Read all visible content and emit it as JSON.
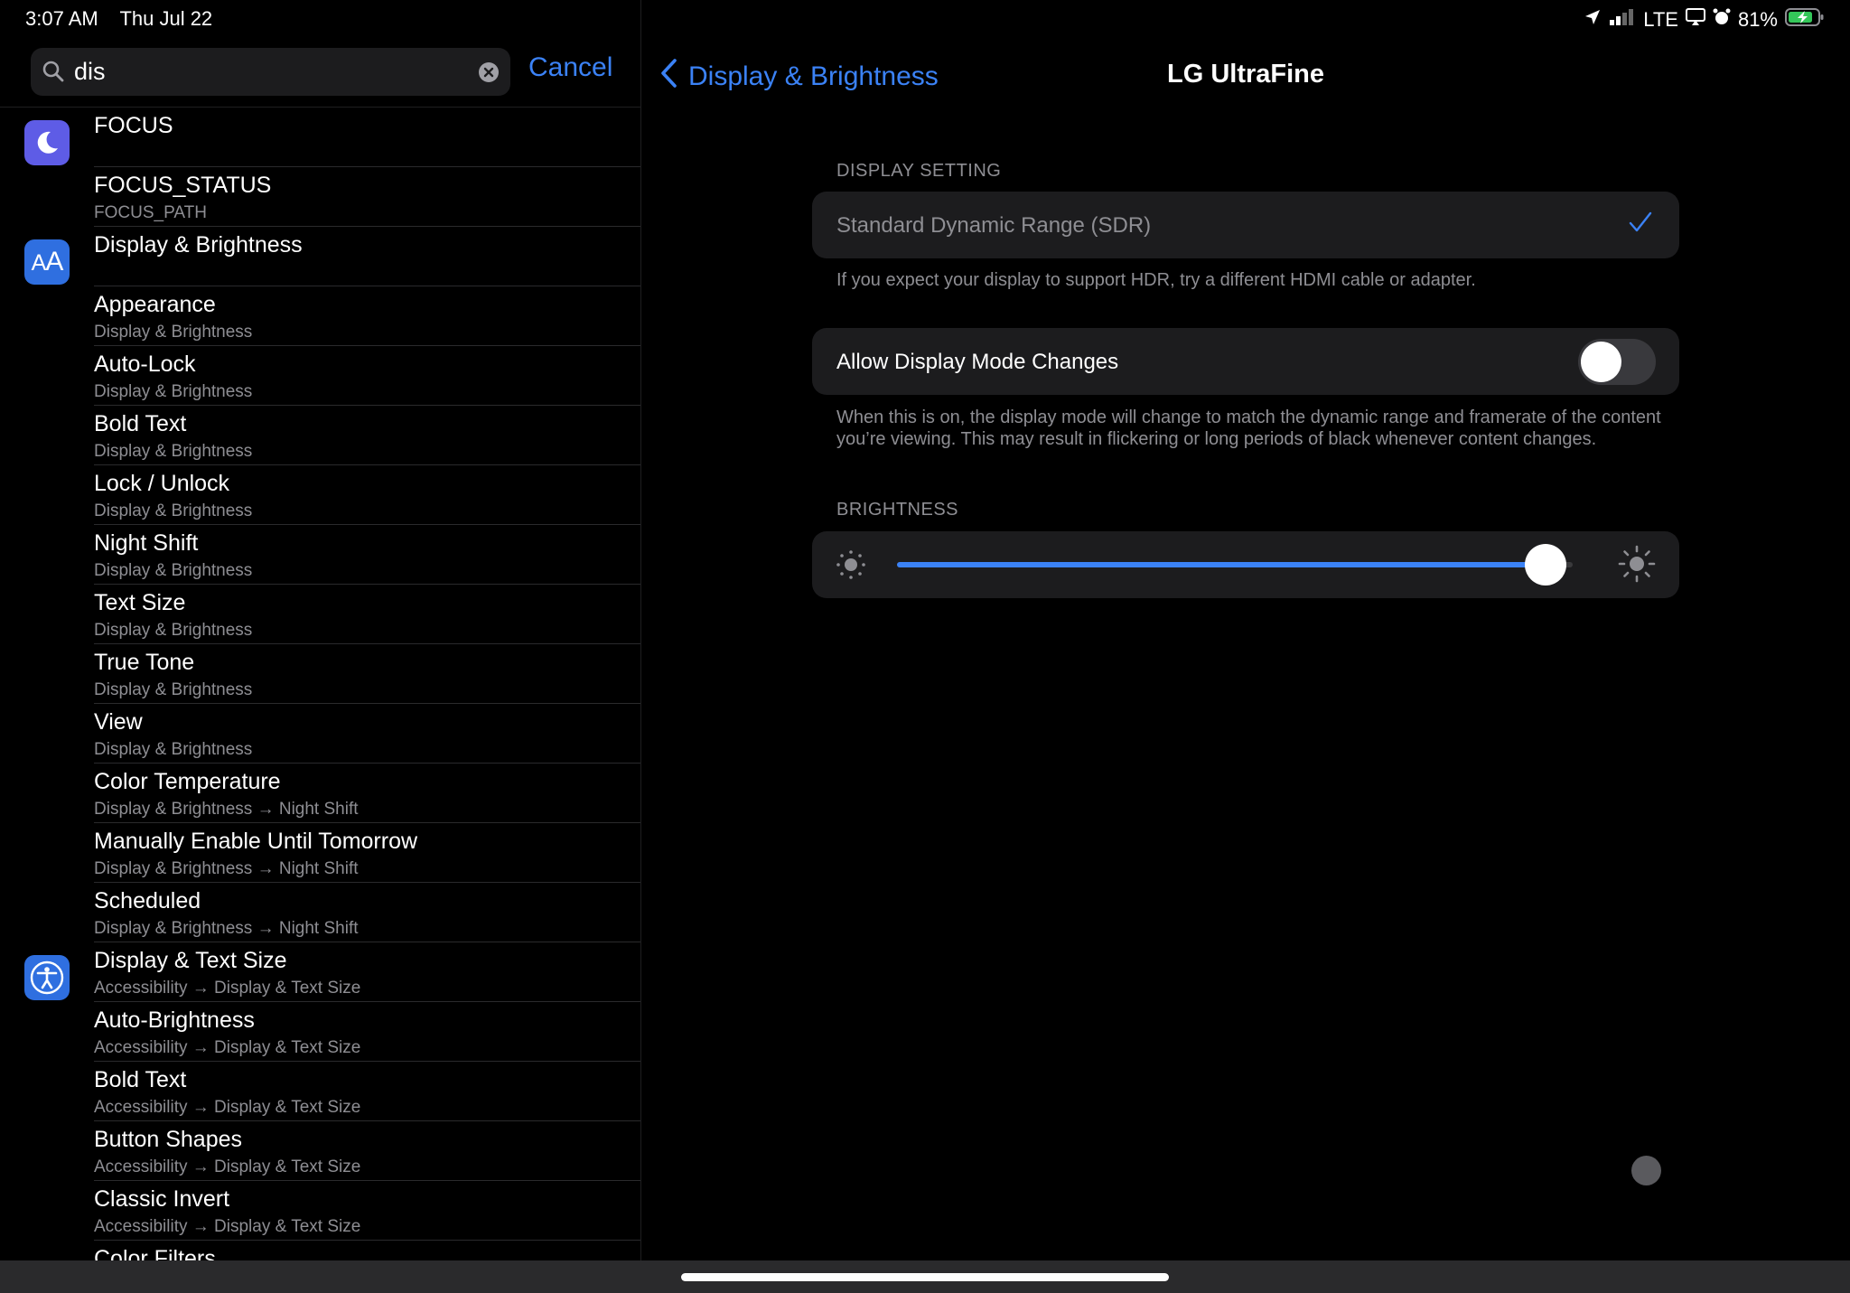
{
  "status_bar": {
    "time": "3:07 AM",
    "date": "Thu Jul 22",
    "network": "LTE",
    "battery": "81%"
  },
  "search": {
    "value": "dis",
    "cancel_label": "Cancel"
  },
  "results": [
    {
      "title": "FOCUS",
      "path": "",
      "icon": "moon-icon",
      "icon_color": "#5e5ce6"
    },
    {
      "title": "FOCUS_STATUS",
      "path": "FOCUS_PATH"
    },
    {
      "title": "Display & Brightness",
      "path": "",
      "icon": "text-size-icon",
      "icon_color": "#2f6fe0"
    },
    {
      "title": "Appearance",
      "path": "Display & Brightness"
    },
    {
      "title": "Auto-Lock",
      "path": "Display & Brightness"
    },
    {
      "title": "Bold Text",
      "path": "Display & Brightness"
    },
    {
      "title": "Lock / Unlock",
      "path": "Display & Brightness"
    },
    {
      "title": "Night Shift",
      "path": "Display & Brightness"
    },
    {
      "title": "Text Size",
      "path": "Display & Brightness"
    },
    {
      "title": "True Tone",
      "path": "Display & Brightness"
    },
    {
      "title": "View",
      "path": "Display & Brightness"
    },
    {
      "title": "Color Temperature",
      "path": "Display & Brightness → Night Shift"
    },
    {
      "title": "Manually Enable Until Tomorrow",
      "path": "Display & Brightness → Night Shift"
    },
    {
      "title": "Scheduled",
      "path": "Display & Brightness → Night Shift"
    },
    {
      "title": "Display & Text Size",
      "path": "Accessibility → Display & Text Size",
      "icon": "accessibility-icon",
      "icon_color": "#2f6fe0"
    },
    {
      "title": "Auto-Brightness",
      "path": "Accessibility → Display & Text Size"
    },
    {
      "title": "Bold Text",
      "path": "Accessibility → Display & Text Size"
    },
    {
      "title": "Button Shapes",
      "path": "Accessibility → Display & Text Size"
    },
    {
      "title": "Classic Invert",
      "path": "Accessibility → Display & Text Size"
    },
    {
      "title": "Color Filters",
      "path": ""
    }
  ],
  "detail": {
    "back_label": "Display & Brightness",
    "title": "LG UltraFine",
    "display_setting": {
      "header": "DISPLAY SETTING",
      "option": "Standard Dynamic Range (SDR)",
      "selected": true,
      "footer": "If you expect your display to support HDR, try a different HDMI cable or adapter."
    },
    "mode_changes": {
      "label": "Allow Display Mode Changes",
      "enabled": false,
      "footer": "When this is on, the display mode will change to match the dynamic range and framerate of the content you’re viewing. This may result in flickering or long periods of black whenever content changes."
    },
    "brightness": {
      "header": "BRIGHTNESS",
      "level": 0.96
    }
  },
  "colors": {
    "accent": "#3b82f6",
    "battery": "#34c759"
  }
}
